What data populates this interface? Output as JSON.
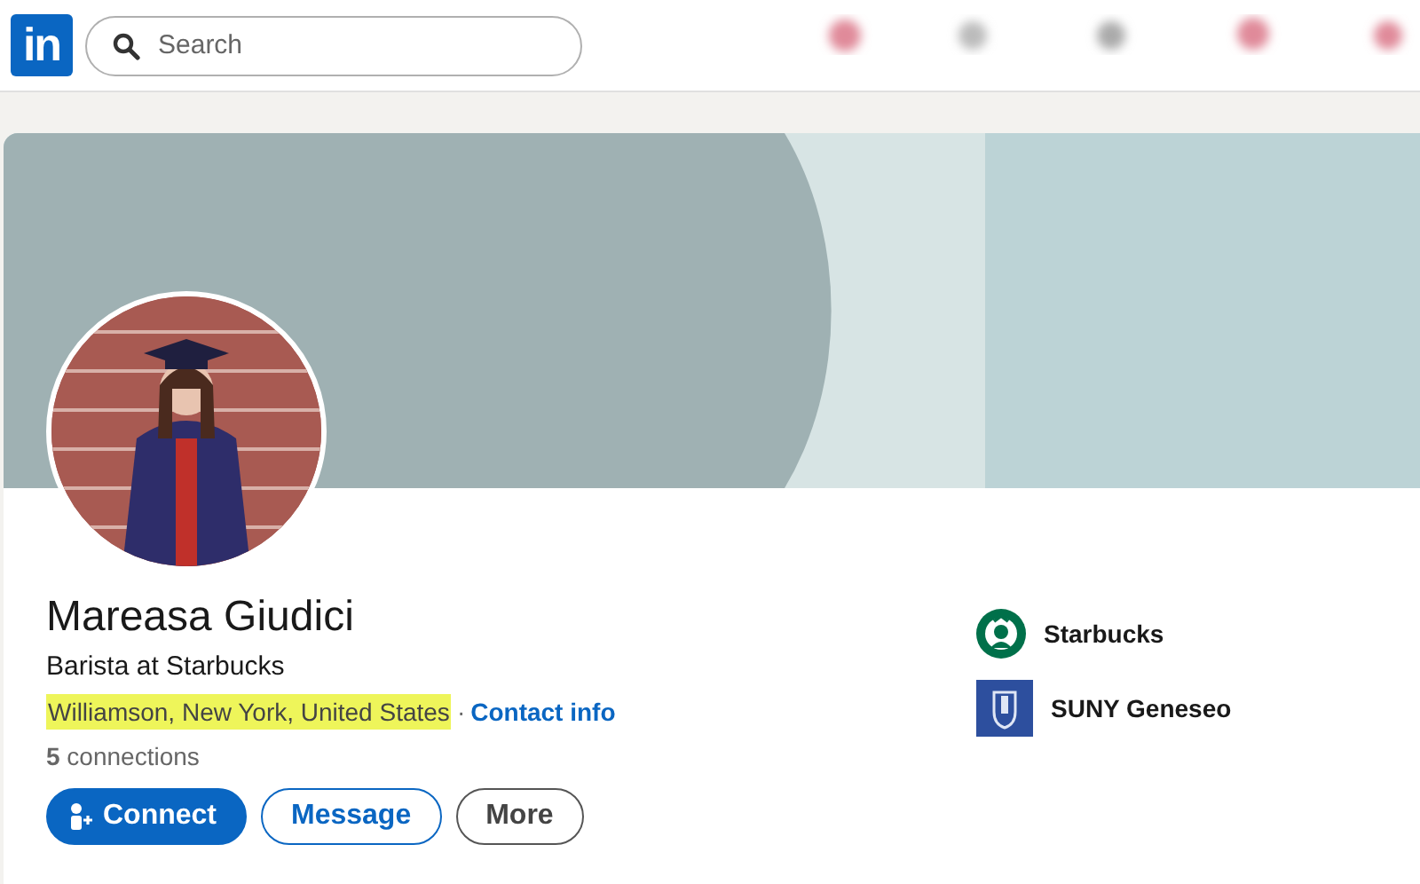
{
  "header": {
    "logo": "in",
    "search": {
      "placeholder": "Search"
    }
  },
  "profile": {
    "name": "Mareasa Giudici",
    "headline": "Barista at Starbucks",
    "location": {
      "text": "Williamson, New York, United States",
      "highlighted": true
    },
    "separator": "·",
    "contact_link": "Contact info",
    "connections": "**5** connections"
  },
  "actions": [
    {
      "label": "Connect",
      "kind": "primary"
    },
    {
      "label": "Message",
      "kind": "outline-blue"
    },
    {
      "label": "More",
      "kind": "outline-gray"
    }
  ],
  "affiliations": [
    {
      "name": "Starbucks",
      "kind": "company"
    },
    {
      "name": "SUNY Geneseo",
      "kind": "school"
    }
  ]
}
